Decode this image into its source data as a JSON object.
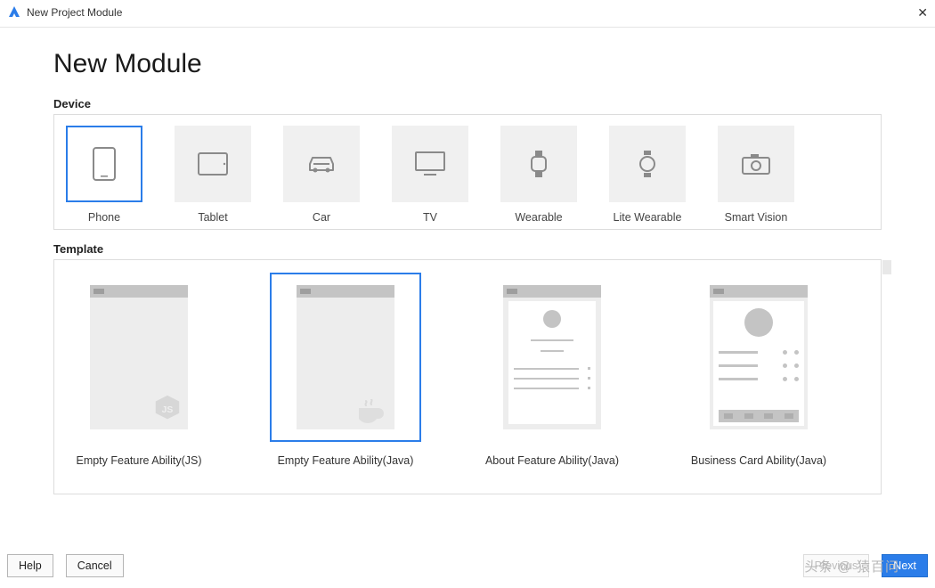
{
  "window": {
    "title": "New Project Module"
  },
  "page": {
    "heading": "New Module"
  },
  "sections": {
    "device": "Device",
    "template": "Template"
  },
  "devices": [
    {
      "id": "phone",
      "label": "Phone",
      "selected": true
    },
    {
      "id": "tablet",
      "label": "Tablet",
      "selected": false
    },
    {
      "id": "car",
      "label": "Car",
      "selected": false
    },
    {
      "id": "tv",
      "label": "TV",
      "selected": false
    },
    {
      "id": "wearable",
      "label": "Wearable",
      "selected": false
    },
    {
      "id": "lite-wearable",
      "label": "Lite Wearable",
      "selected": false
    },
    {
      "id": "smart-vision",
      "label": "Smart Vision",
      "selected": false
    }
  ],
  "templates": [
    {
      "id": "empty-js",
      "label": "Empty Feature Ability(JS)",
      "selected": false
    },
    {
      "id": "empty-java",
      "label": "Empty Feature Ability(Java)",
      "selected": true
    },
    {
      "id": "about-java",
      "label": "About Feature Ability(Java)",
      "selected": false
    },
    {
      "id": "business-card-java",
      "label": "Business Card Ability(Java)",
      "selected": false
    }
  ],
  "buttons": {
    "help": "Help",
    "cancel": "Cancel",
    "previous": "Previous",
    "next": "Next"
  },
  "watermark": "头条 @ 猿百问",
  "colors": {
    "accent": "#2b7de9",
    "tile": "#f0f0f0",
    "border": "#dcdcdc"
  }
}
